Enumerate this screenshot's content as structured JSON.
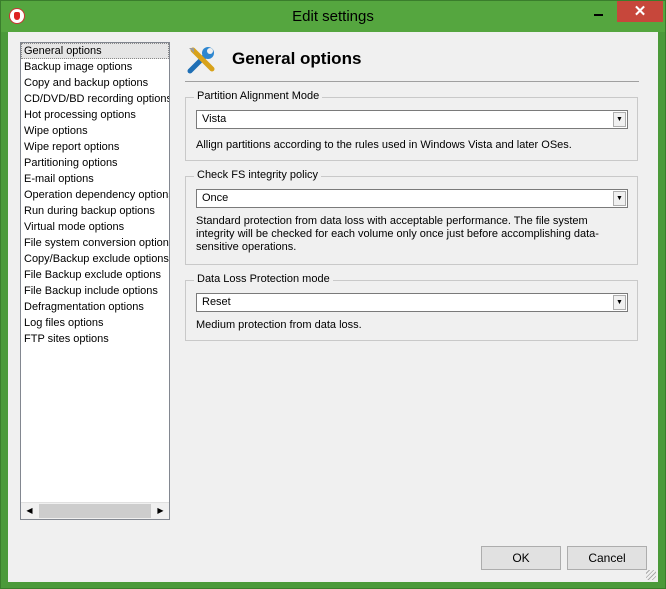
{
  "window": {
    "title": "Edit settings",
    "close_symbol": "✕"
  },
  "nav": {
    "items": [
      "General options",
      "Backup image options",
      "Copy and backup options",
      "CD/DVD/BD recording options",
      "Hot processing options",
      "Wipe options",
      "Wipe report options",
      "Partitioning options",
      "E-mail options",
      "Operation dependency options",
      "Run during backup options",
      "Virtual mode options",
      "File system conversion options",
      "Copy/Backup exclude options",
      "File Backup exclude options",
      "File Backup include options",
      "Defragmentation options",
      "Log files options",
      "FTP sites options"
    ],
    "selected_index": 0
  },
  "header": {
    "title": "General options",
    "icon": "tools-icon"
  },
  "groups": {
    "partition": {
      "label": "Partition Alignment Mode",
      "value": "Vista",
      "description": "Allign partitions according to the rules used in Windows Vista and later OSes."
    },
    "fs_check": {
      "label": "Check FS integrity policy",
      "value": "Once",
      "description": "Standard protection from data loss with acceptable performance. The file system integrity will be checked for each volume only once just before accomplishing data-sensitive operations."
    },
    "data_loss": {
      "label": "Data Loss Protection mode",
      "value": "Reset",
      "description": "Medium protection from data loss."
    }
  },
  "buttons": {
    "ok": "OK",
    "cancel": "Cancel"
  },
  "colors": {
    "titlebar": "#55a63f",
    "close": "#c7473b",
    "client": "#f0f0f0"
  }
}
